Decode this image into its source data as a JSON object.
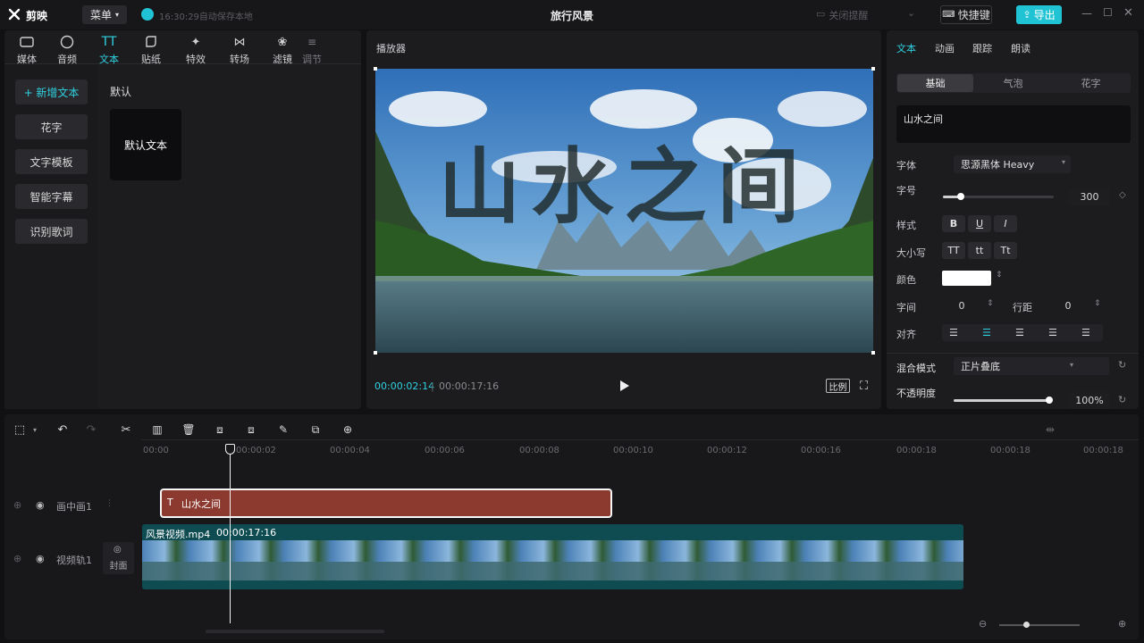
{
  "app": {
    "name": "剪映",
    "project_title": "旅行风景",
    "menu_label": "菜单",
    "autosave_text": "16:30:29自动保存本地",
    "close_title_label": "关闭提醒"
  },
  "header": {
    "shortcut_label": "快捷键",
    "export_label": "导出"
  },
  "toolbar": {
    "items": [
      {
        "label": "媒体"
      },
      {
        "label": "音频"
      },
      {
        "label": "文本"
      },
      {
        "label": "贴纸"
      },
      {
        "label": "特效"
      },
      {
        "label": "转场"
      },
      {
        "label": "滤镜"
      },
      {
        "label": "调节"
      }
    ],
    "active_index": 2
  },
  "text_sidebar": {
    "items": [
      {
        "label": "+ 新增文本"
      },
      {
        "label": "花字"
      },
      {
        "label": "文字模板"
      },
      {
        "label": "智能字幕"
      },
      {
        "label": "识别歌词"
      }
    ],
    "section_title": "默认",
    "card_label": "默认文本"
  },
  "player": {
    "title": "播放器",
    "overlay_text": "山水之间",
    "current_time": "00:00:02:14",
    "total_time": "00:00:17:16",
    "ratio_label": "比例"
  },
  "inspector": {
    "tabs": [
      {
        "label": "文本"
      },
      {
        "label": "动画"
      },
      {
        "label": "跟踪"
      },
      {
        "label": "朗读"
      }
    ],
    "subtabs": [
      {
        "label": "基础"
      },
      {
        "label": "气泡"
      },
      {
        "label": "花字"
      }
    ],
    "text_value": "山水之间",
    "font_label": "字体",
    "font_value": "思源黑体 Heavy",
    "size_label": "字号",
    "size_value": "300",
    "size_slider_fraction": 0.16,
    "style_label": "样式",
    "style_buttons": [
      "B",
      "U",
      "I"
    ],
    "case_label": "大小写",
    "case_buttons": [
      "TT",
      "tt",
      "Tt"
    ],
    "color_label": "颜色",
    "color_value": "#ffffff",
    "letter_spacing_label": "字间",
    "letter_spacing_value": "0",
    "line_spacing_label": "行距",
    "line_spacing_value": "0",
    "align_label": "对齐",
    "blend_label": "混合模式",
    "blend_value": "正片叠底",
    "opacity_label": "不透明度",
    "opacity_value": "100%",
    "opacity_fraction": 1.0
  },
  "timeline": {
    "ruler": [
      "00:00",
      "00:00:02",
      "00:00:04",
      "00:00:06",
      "00:00:08",
      "00:00:10",
      "00:00:12",
      "00:00:16",
      "00:00:18",
      "00:00:18"
    ],
    "tracks": [
      {
        "name": "画中画1"
      },
      {
        "name": "视频轨1"
      }
    ],
    "cover_label": "封面",
    "text_clip_label": "山水之间",
    "video_clip_name": "风景视频.mp4",
    "video_clip_duration": "00:00:17:16"
  },
  "colors": {
    "accent": "#2fd1e0",
    "export": "#20c3d3",
    "text_clip": "#8c3a30",
    "video_clip": "#0e4c52"
  }
}
